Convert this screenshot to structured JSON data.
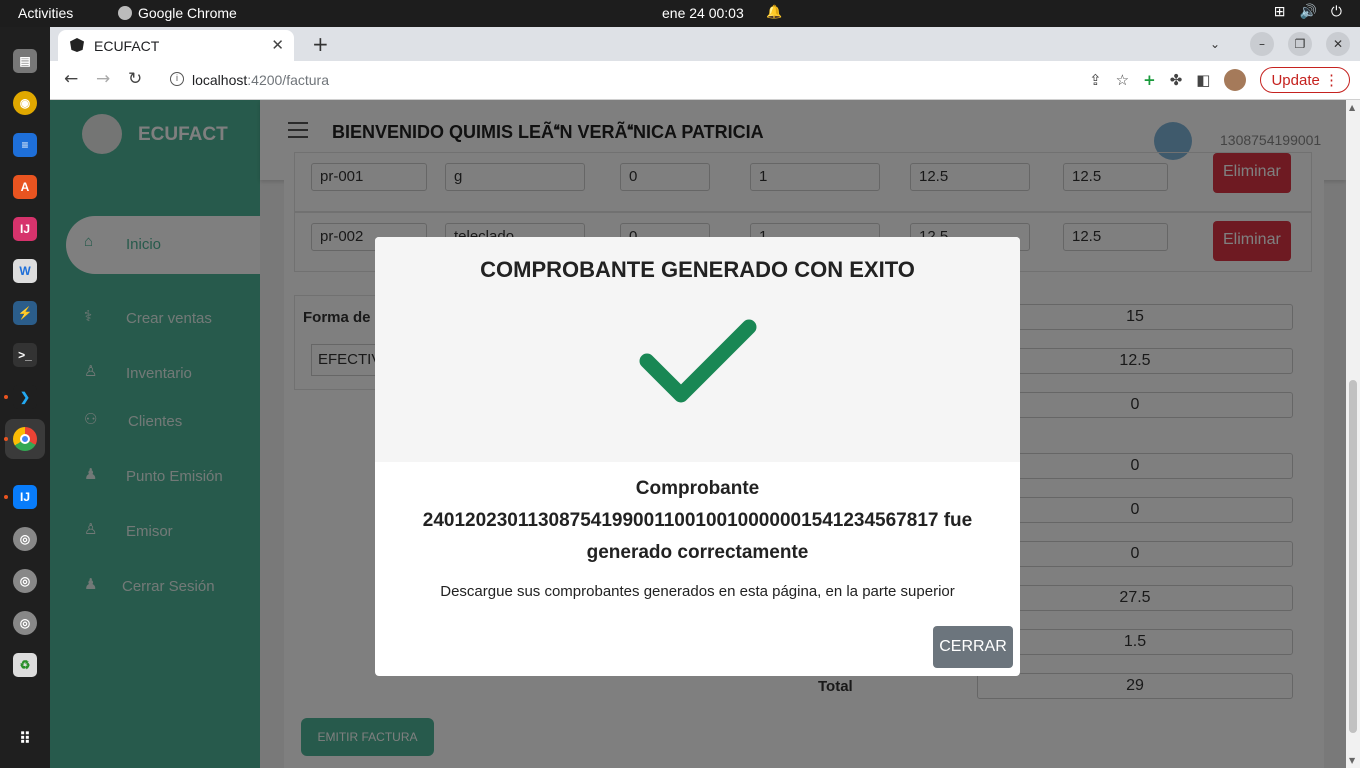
{
  "os": {
    "activities": "Activities",
    "app_name": "Google Chrome",
    "clock": "ene 24  00:03"
  },
  "browser": {
    "tab_title": "ECUFACT",
    "url_host": "localhost",
    "url_path": ":4200/factura",
    "update_label": "Update"
  },
  "app": {
    "brand": "ECUFACT",
    "welcome": "BIENVENIDO QUIMIS LEÃN VERÃNICA PATRICIA",
    "user_id": "1308754199001",
    "sidebar": [
      {
        "label": "Inicio",
        "icon": "home-icon"
      },
      {
        "label": "Crear ventas",
        "icon": "stethoscope-icon"
      },
      {
        "label": "Inventario",
        "icon": "user-icon"
      },
      {
        "label": "Clientes",
        "icon": "users-icon"
      },
      {
        "label": "Punto Emisión",
        "icon": "user-tie-icon"
      },
      {
        "label": "Emisor",
        "icon": "user-icon"
      },
      {
        "label": "Cerrar Sesión",
        "icon": "user-tie-icon"
      }
    ],
    "row1": {
      "code": "pr-001",
      "desc": "g",
      "c3": "0",
      "c4": "1",
      "c5": "12.5",
      "c6": "12.5",
      "delete": "Eliminar"
    },
    "row2": {
      "code": "pr-002",
      "desc": "teleclado",
      "c3": "0",
      "c4": "1",
      "c5": "12.5",
      "c6": "12.5",
      "delete": "Eliminar"
    },
    "payment_label": "Forma de",
    "payment_value": "EFECTIV",
    "totals": [
      "15",
      "12.5",
      "0",
      "0",
      "0",
      "0",
      "27.5",
      "1.5",
      "29"
    ],
    "total_label": "Total",
    "emit_button": "EMITIR FACTURA"
  },
  "modal": {
    "title": "COMPROBANTE GENERADO CON EXITO",
    "message": "Comprobante 2401202301130875419900110010010000001541234567817 fue generado correctamente",
    "description": "Descargue sus comprobantes generados en esta página, en la parte superior",
    "close": "CERRAR",
    "check_color": "#198754"
  }
}
